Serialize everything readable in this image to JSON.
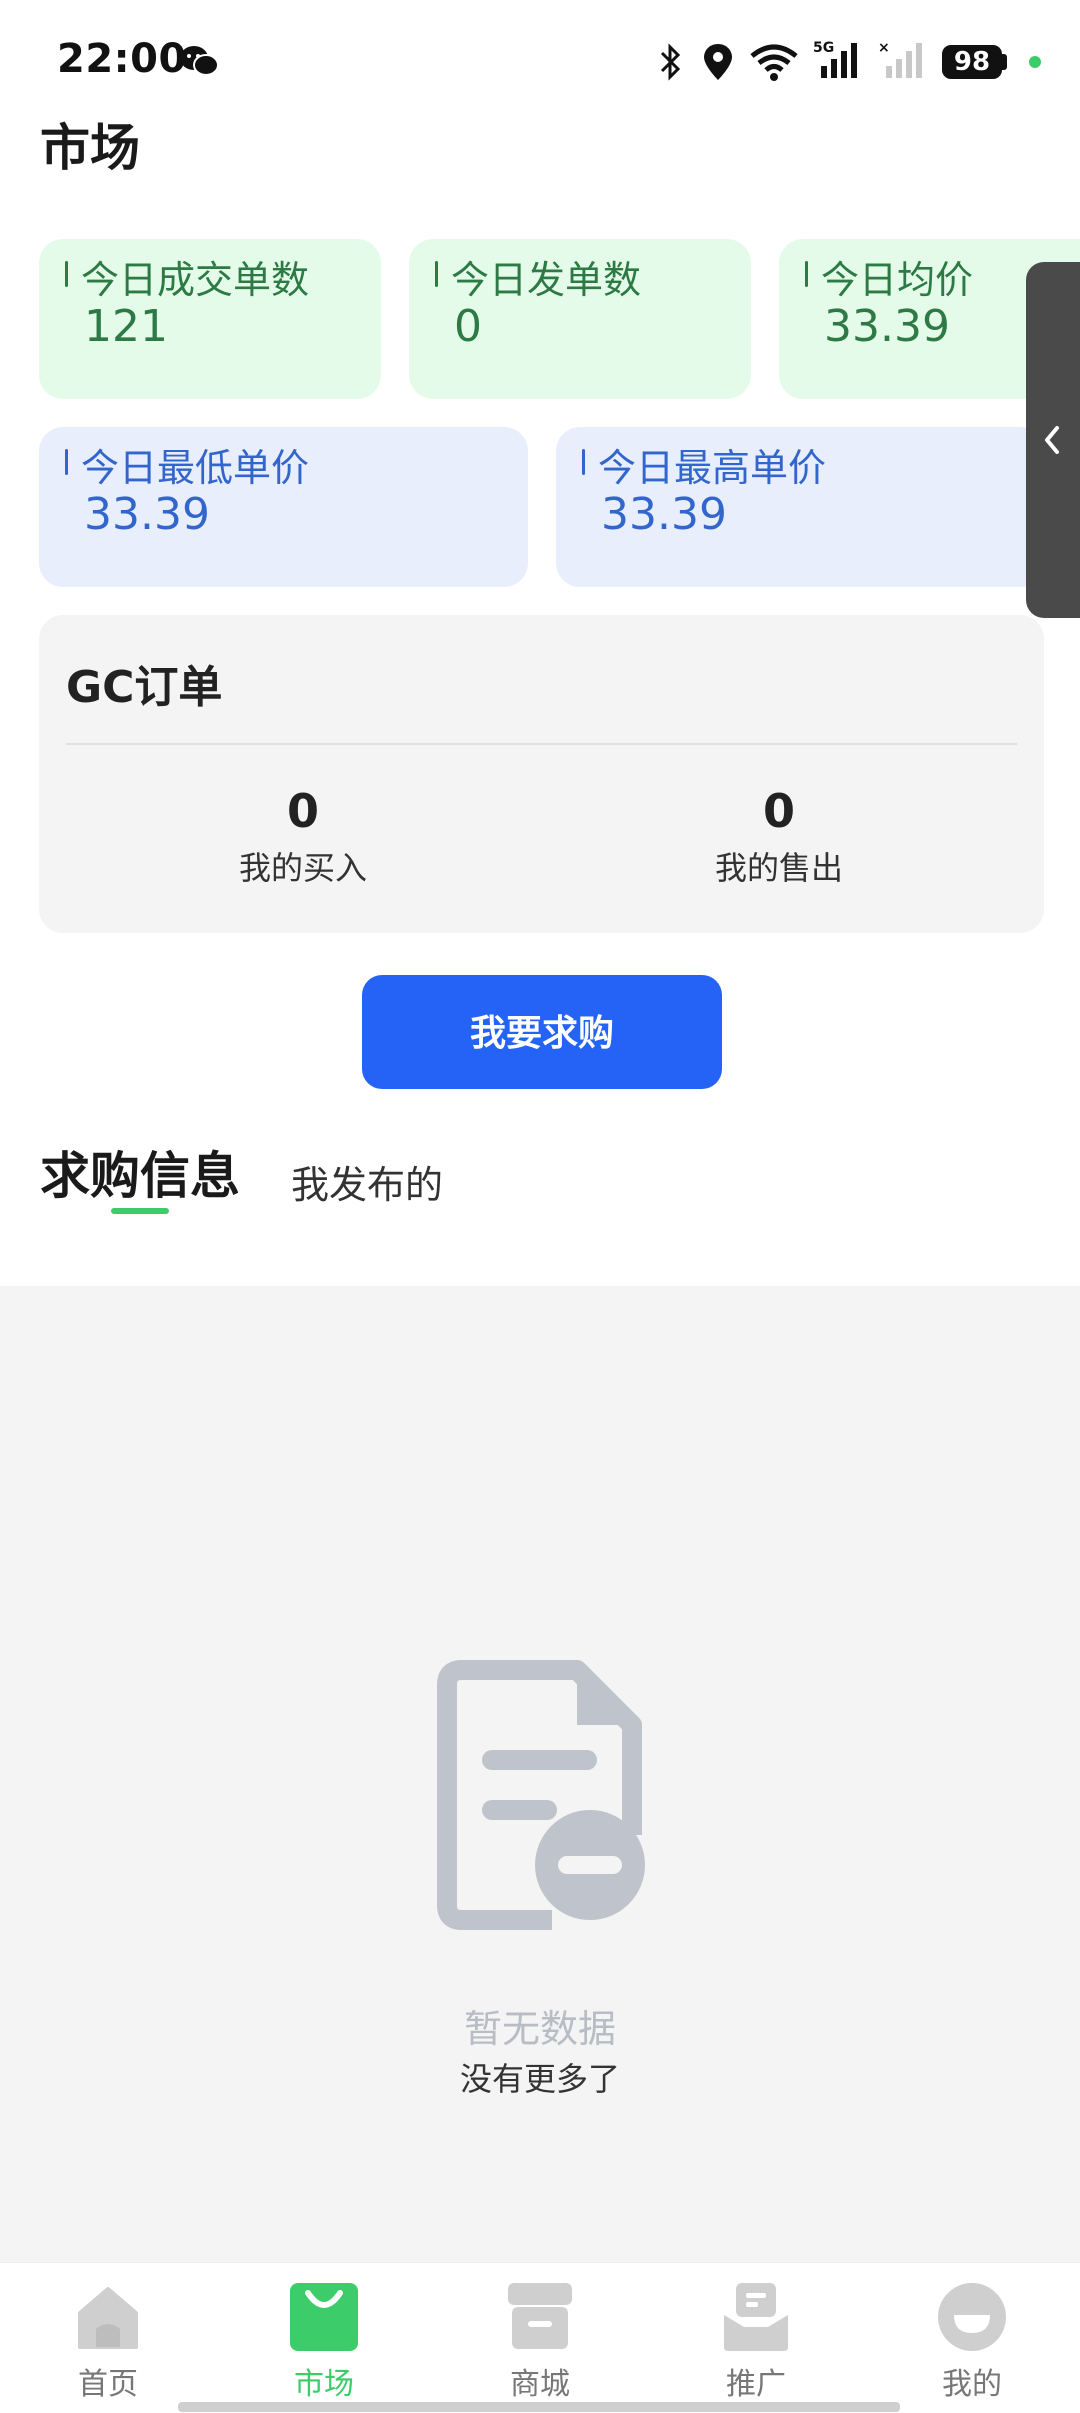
{
  "status_bar": {
    "time": "22:00",
    "battery": "98",
    "icons": [
      "wechat-icon",
      "bluetooth-icon",
      "location-icon",
      "wifi-icon",
      "signal-5g-icon",
      "signal-no-sim-icon"
    ]
  },
  "page": {
    "title": "市场"
  },
  "stats": [
    {
      "label": "今日成交单数",
      "value": "121"
    },
    {
      "label": "今日发单数",
      "value": "0"
    },
    {
      "label": "今日均价",
      "value": "33.39"
    },
    {
      "label": "今日最低单价",
      "value": "33.39"
    },
    {
      "label": "今日最高单价",
      "value": "33.39"
    }
  ],
  "gc_orders": {
    "title": "GC订单",
    "buy": {
      "value": "0",
      "label": "我的买入"
    },
    "sell": {
      "value": "0",
      "label": "我的售出"
    }
  },
  "request_button": "我要求购",
  "tabs": {
    "active": "求购信息",
    "other": "我发布的"
  },
  "empty": {
    "title": "暂无数据",
    "subtitle": "没有更多了"
  },
  "bottom_nav": [
    {
      "label": "首页",
      "icon": "home-icon"
    },
    {
      "label": "市场",
      "icon": "shopping-bag-icon",
      "active": true
    },
    {
      "label": "商城",
      "icon": "store-icon"
    },
    {
      "label": "推广",
      "icon": "mail-tray-icon"
    },
    {
      "label": "我的",
      "icon": "profile-icon"
    }
  ],
  "colors": {
    "accent": "#3ccd6a",
    "primary_button": "#2563f6",
    "stat_green": "#2d7a44",
    "stat_blue": "#3366cc"
  }
}
